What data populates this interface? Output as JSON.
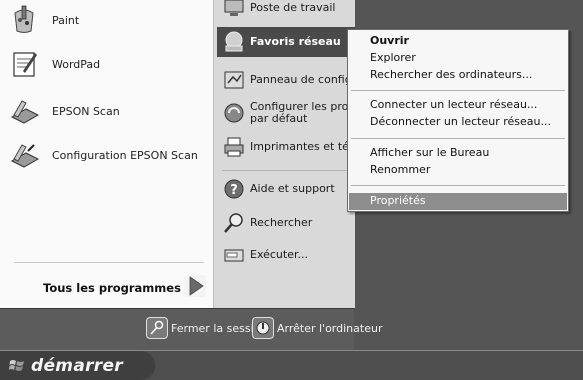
{
  "left_programs": [
    {
      "label": "Paint",
      "icon": "paint-icon"
    },
    {
      "label": "WordPad",
      "icon": "wordpad-icon"
    },
    {
      "label": "EPSON Scan",
      "icon": "scanner-icon"
    },
    {
      "label": "Configuration EPSON Scan",
      "icon": "scanner-config-icon"
    }
  ],
  "all_programs_label": "Tous les programmes",
  "right_items": [
    {
      "label": "Poste de travail",
      "icon": "computer-icon"
    },
    {
      "label": "Favoris réseau",
      "icon": "network-places-icon"
    },
    {
      "label": "Panneau de config",
      "icon": "control-panel-icon"
    },
    {
      "label_line1": "Configurer les pro",
      "label_line2": "par défaut",
      "icon": "default-programs-icon"
    },
    {
      "label": "Imprimantes et té",
      "icon": "printer-icon"
    },
    {
      "label": "Aide et support",
      "icon": "help-icon"
    },
    {
      "label": "Rechercher",
      "icon": "search-icon"
    },
    {
      "label": "Exécuter...",
      "icon": "run-icon"
    }
  ],
  "bottom_bar": {
    "logout_label": "Fermer la session",
    "shutdown_label": "Arrêter l'ordinateur"
  },
  "context_menu": {
    "items": [
      {
        "label": "Ouvrir"
      },
      {
        "label": "Explorer"
      },
      {
        "label": "Rechercher des ordinateurs..."
      },
      {
        "label": "Connecter un lecteur réseau..."
      },
      {
        "label": "Déconnecter un lecteur réseau..."
      },
      {
        "label": "Afficher sur le Bureau"
      },
      {
        "label": "Renommer"
      },
      {
        "label": "Propriétés"
      }
    ]
  },
  "taskbar": {
    "start_label": "démarrer"
  }
}
